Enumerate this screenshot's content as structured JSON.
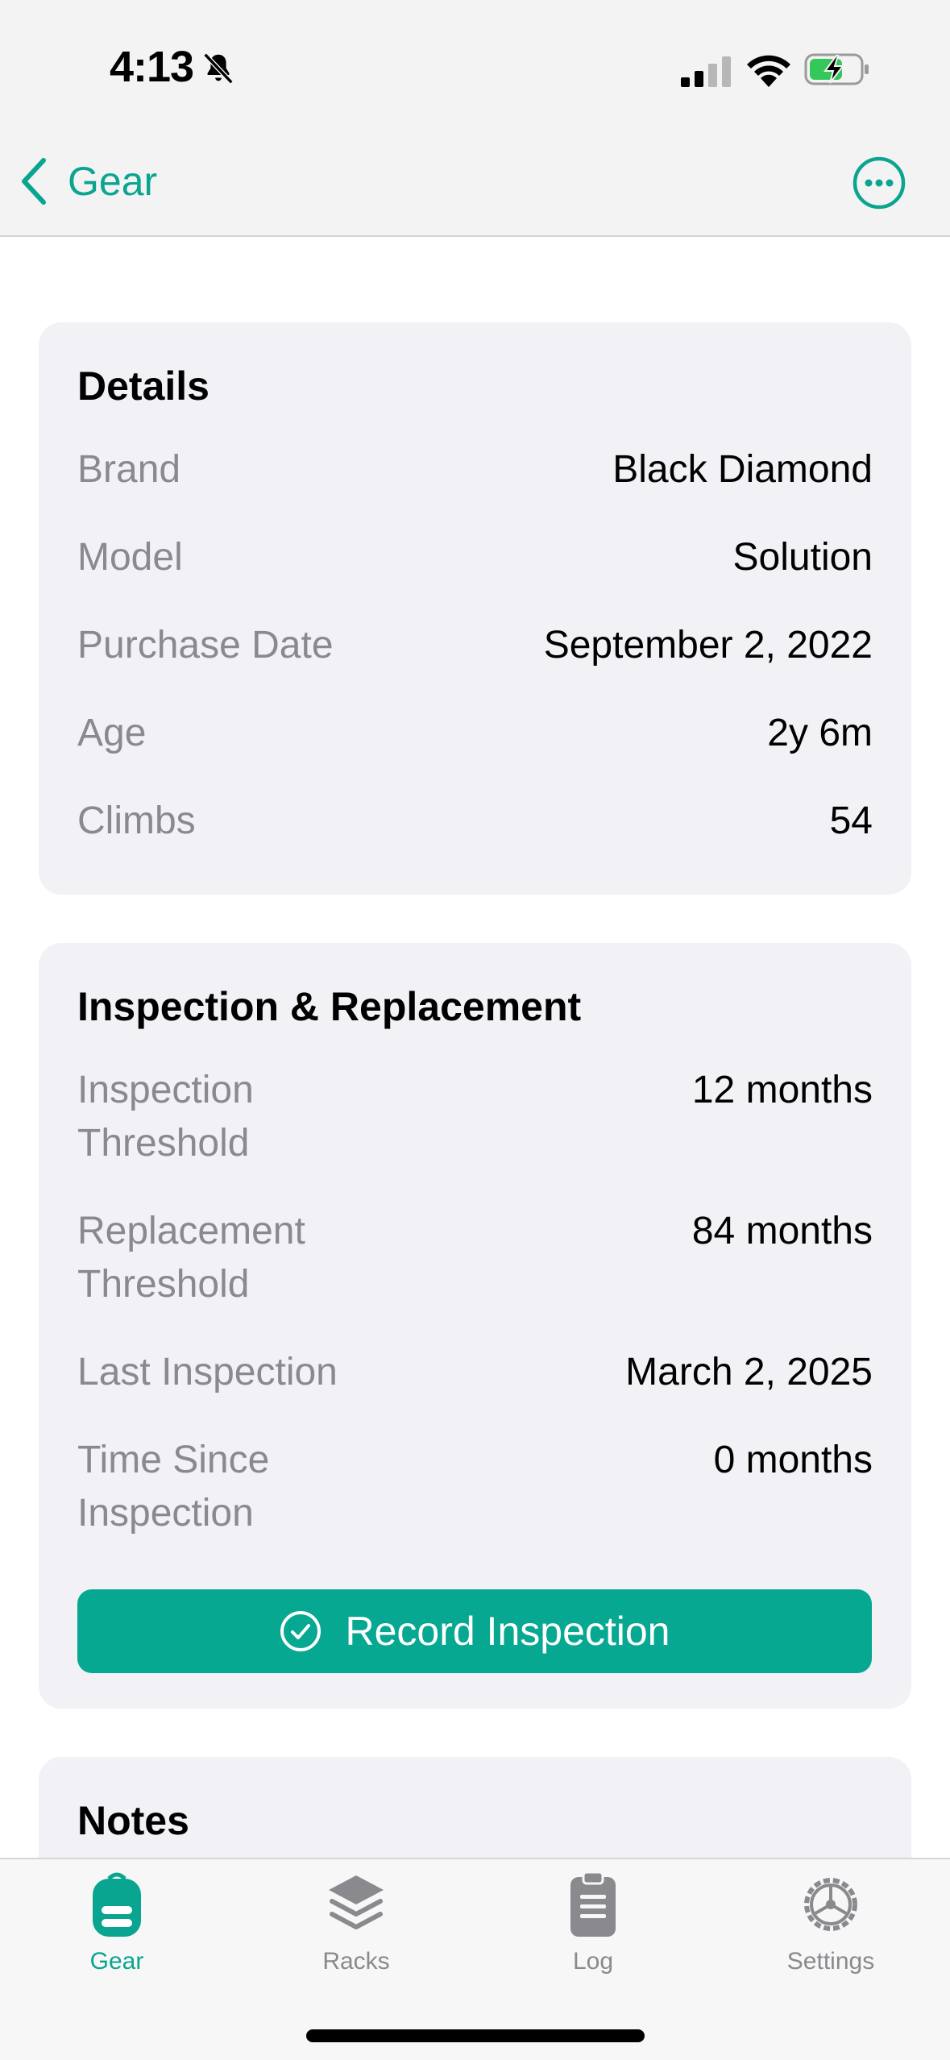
{
  "status_bar": {
    "time": "4:13"
  },
  "header": {
    "back_label": "Gear"
  },
  "details": {
    "title": "Details",
    "rows": [
      {
        "label": "Brand",
        "value": "Black Diamond"
      },
      {
        "label": "Model",
        "value": "Solution"
      },
      {
        "label": "Purchase Date",
        "value": "September 2, 2022"
      },
      {
        "label": "Age",
        "value": "2y 6m"
      },
      {
        "label": "Climbs",
        "value": "54"
      }
    ]
  },
  "inspection": {
    "title": "Inspection & Replacement",
    "rows": [
      {
        "label": "Inspection Threshold",
        "value": "12 months"
      },
      {
        "label": "Replacement Threshold",
        "value": "84 months"
      },
      {
        "label": "Last Inspection",
        "value": "March 2, 2025"
      },
      {
        "label": "Time Since Inspection",
        "value": "0 months"
      }
    ],
    "button_label": "Record Inspection"
  },
  "notes": {
    "title": "Notes"
  },
  "tabbar": {
    "tabs": [
      {
        "label": "Gear",
        "icon": "backpack-icon",
        "active": true
      },
      {
        "label": "Racks",
        "icon": "layers-icon",
        "active": false
      },
      {
        "label": "Log",
        "icon": "clipboard-icon",
        "active": false
      },
      {
        "label": "Settings",
        "icon": "gear-icon",
        "active": false
      }
    ]
  },
  "colors": {
    "accent": "#0aa590",
    "button": "#06a891",
    "card_bg": "#f1f1f6",
    "secondary_text": "#8a8a8e"
  }
}
